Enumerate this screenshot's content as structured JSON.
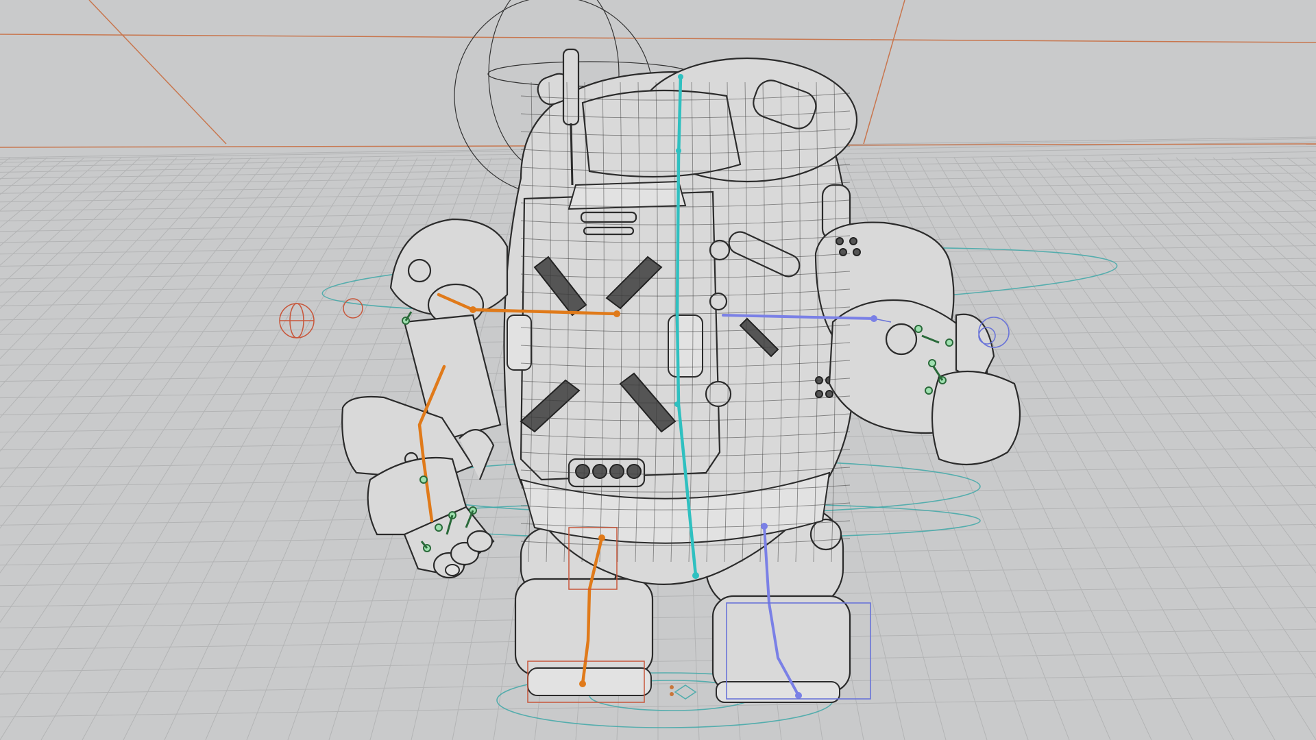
{
  "viewport": {
    "background": "#c9cacb",
    "grid_color": "#b3b4b5",
    "horizon_color": "#c8764e"
  },
  "rig": {
    "colors": {
      "left_chain": "#e07a1a",
      "right_chain": "#7a80e6",
      "spine": "#2fc0c0",
      "controls": "#3fa8a8",
      "ik_handles": "#9fe0b0"
    }
  },
  "icons": [
    "grid-floor",
    "robot-mesh",
    "spine-bone",
    "left-arm-bones",
    "right-arm-bones",
    "left-leg-bones",
    "right-leg-bones",
    "root-control",
    "head-control"
  ]
}
